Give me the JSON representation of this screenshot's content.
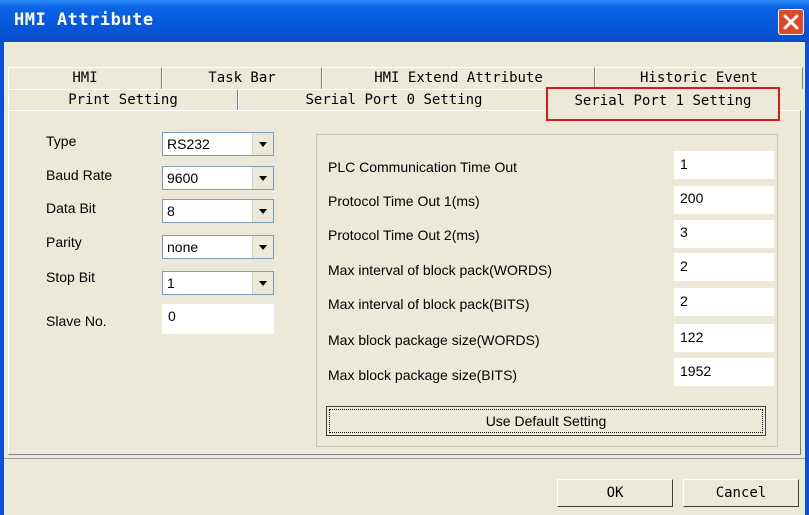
{
  "window": {
    "title": "HMI Attribute"
  },
  "tabs": {
    "row1": [
      "HMI",
      "Task Bar",
      "HMI Extend Attribute",
      "Historic Event"
    ],
    "row2": [
      "Print Setting",
      "Serial Port 0 Setting",
      "Serial Port 1 Setting"
    ],
    "active": "Serial Port 1 Setting",
    "highlight_color": "#e01818"
  },
  "left": {
    "type": {
      "label": "Type",
      "value": "RS232"
    },
    "baud": {
      "label": "Baud Rate",
      "value": "9600"
    },
    "databit": {
      "label": "Data Bit",
      "value": "8"
    },
    "parity": {
      "label": "Parity",
      "value": "none"
    },
    "stopbit": {
      "label": "Stop Bit",
      "value": "1"
    },
    "slave": {
      "label": "Slave No.",
      "value": "0"
    }
  },
  "right": {
    "rows": [
      {
        "label": "PLC Communication Time Out",
        "value": "1"
      },
      {
        "label": "Protocol Time Out 1(ms)",
        "value": "200"
      },
      {
        "label": "Protocol Time Out 2(ms)",
        "value": "3"
      },
      {
        "label": "Max interval of block pack(WORDS)",
        "value": "2"
      },
      {
        "label": "Max interval of block pack(BITS)",
        "value": "2"
      },
      {
        "label": "Max block package size(WORDS)",
        "value": "122"
      },
      {
        "label": "Max block package size(BITS)",
        "value": "1952"
      }
    ],
    "default_button": "Use Default Setting"
  },
  "footer": {
    "ok": "OK",
    "cancel": "Cancel"
  },
  "icons": {
    "close": "close-icon",
    "dropdown": "chevron-down-icon"
  }
}
